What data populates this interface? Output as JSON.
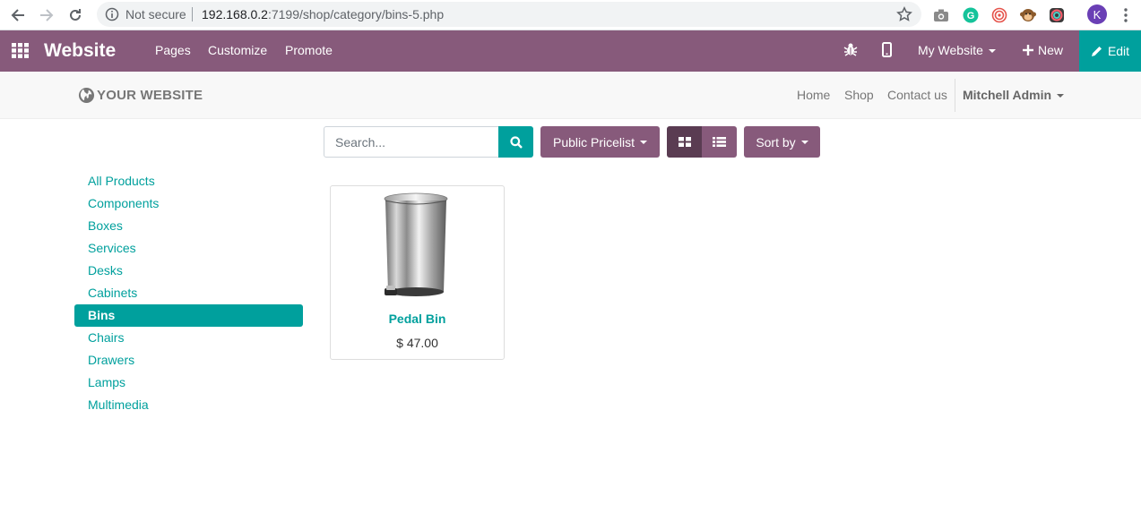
{
  "browser": {
    "security_label": "Not secure",
    "url_host": "192.168.0.2",
    "url_path": ":7199/shop/category/bins-5.php",
    "profile_initial": "K"
  },
  "odoo_nav": {
    "brand": "Website",
    "menu": [
      "Pages",
      "Customize",
      "Promote"
    ],
    "site_selector": "My Website",
    "new_label": "New",
    "edit_label": "Edit",
    "colors": {
      "bar": "#875a7b",
      "edit": "#00a09d"
    }
  },
  "site_header": {
    "logo_text": "YOUR WEBSITE",
    "links": [
      "Home",
      "Shop",
      "Contact us"
    ],
    "user": "Mitchell Admin"
  },
  "toolbar": {
    "search_placeholder": "Search...",
    "pricelist_label": "Public Pricelist",
    "sort_label": "Sort by",
    "active_view": "grid"
  },
  "categories": {
    "items": [
      "All Products",
      "Components",
      "Boxes",
      "Services",
      "Desks",
      "Cabinets",
      "Bins",
      "Chairs",
      "Drawers",
      "Lamps",
      "Multimedia"
    ],
    "active": "Bins"
  },
  "products": [
    {
      "name": "Pedal Bin",
      "price": "$ 47.00",
      "image_icon": "pedal-bin-image"
    }
  ]
}
